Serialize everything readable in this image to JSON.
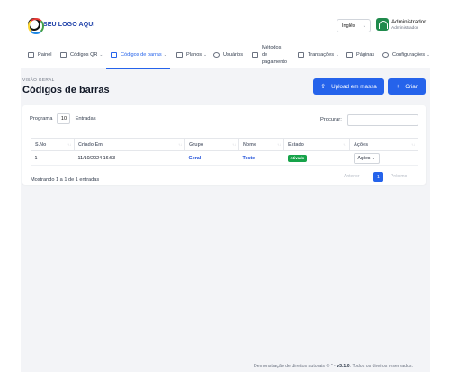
{
  "brand": {
    "logo_text": "SEU LOGO AQUI"
  },
  "header": {
    "language": "Inglês",
    "user_name": "Administrador",
    "user_role": "Administrador"
  },
  "nav": {
    "items": [
      {
        "label": "Painel",
        "icon": "home-icon",
        "dropdown": false
      },
      {
        "label": "Códigos QR",
        "icon": "qr-code-icon",
        "dropdown": true
      },
      {
        "label": "Códigos de barras",
        "icon": "barcode-icon",
        "dropdown": true,
        "active": true
      },
      {
        "label": "Planos",
        "icon": "plans-icon",
        "dropdown": true
      },
      {
        "label": "Usuários",
        "icon": "users-icon",
        "dropdown": false
      },
      {
        "label": "Métodos de pagamento",
        "label_lines": [
          "Métodos",
          "de",
          "pagamento"
        ],
        "icon": "payment-icon",
        "dropdown": false
      },
      {
        "label": "Transações",
        "icon": "transactions-icon",
        "dropdown": true
      },
      {
        "label": "Páginas",
        "icon": "pages-icon",
        "dropdown": false
      },
      {
        "label": "Configurações",
        "icon": "settings-icon",
        "dropdown": true
      }
    ]
  },
  "page": {
    "kicker": "VISÃO GERAL",
    "title": "Códigos de barras",
    "upload_label": "Upload em massa",
    "create_label": "Criar"
  },
  "table": {
    "length_prefix": "Programa",
    "length_value": "10",
    "length_suffix": "Entradas",
    "search_label": "Procurar:",
    "search_value": "",
    "columns": [
      "S.No",
      "Criado Em",
      "Grupo",
      "Nome",
      "Estado",
      "Ações"
    ],
    "rows": [
      {
        "sno": "1",
        "created": "11/10/2024 16:53",
        "group": "Geral",
        "name": "Teste",
        "status": "Ativado",
        "action": "Ações"
      }
    ],
    "info": "Mostrando 1 a 1 de 1 entradas",
    "pagination": {
      "prev": "Anterior",
      "current": "1",
      "next": "Próximo"
    }
  },
  "footer": {
    "prefix": "Demonstração de direitos autorais ©",
    "quote": "\"",
    "dash": "-",
    "version": "v3.1.0",
    "suffix": ". Todos os direitos reservados."
  },
  "colors": {
    "accent": "#2563eb",
    "success": "#16a34a",
    "brand_avatar": "#1f8a4c"
  }
}
